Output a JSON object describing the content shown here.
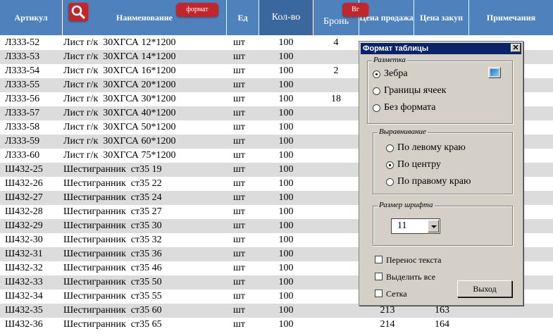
{
  "header": {
    "col_article": "Артикул",
    "col_name": "Наименование",
    "col_unit": "Ед",
    "col_qty": "Кол-во",
    "col_bron": "Бронь",
    "col_sell": "Цена продажа",
    "col_buy": "Цена закуп",
    "col_notes": "Примечания",
    "format_button": "формат",
    "bg_button": "Вг",
    "search_icon": "search-icon",
    "button_color": "#c0272d",
    "header_color": "#4f81bd"
  },
  "rows": [
    {
      "article": "Л333-52",
      "name": "Лист г/к  30ХГСА 12*1200",
      "unit": "шт",
      "qty": "100",
      "bron": "4",
      "sell": "",
      "buy": ""
    },
    {
      "article": "Л333-53",
      "name": "Лист г/к  30ХГСА 14*1200",
      "unit": "шт",
      "qty": "100",
      "bron": "",
      "sell": "",
      "buy": ""
    },
    {
      "article": "Л333-54",
      "name": "Лист г/к  30ХГСА 16*1200",
      "unit": "шт",
      "qty": "100",
      "bron": "2",
      "sell": "",
      "buy": ""
    },
    {
      "article": "Л333-55",
      "name": "Лист г/к  30ХГСА 20*1200",
      "unit": "шт",
      "qty": "100",
      "bron": "",
      "sell": "",
      "buy": ""
    },
    {
      "article": "Л333-56",
      "name": "Лист г/к  30ХГСА 30*1200",
      "unit": "шт",
      "qty": "100",
      "bron": "18",
      "sell": "",
      "buy": ""
    },
    {
      "article": "Л333-57",
      "name": "Лист г/к  30ХГСА 40*1200",
      "unit": "шт",
      "qty": "100",
      "bron": "",
      "sell": "",
      "buy": ""
    },
    {
      "article": "Л333-58",
      "name": "Лист г/к  30ХГСА 50*1200",
      "unit": "шт",
      "qty": "100",
      "bron": "",
      "sell": "",
      "buy": ""
    },
    {
      "article": "Л333-59",
      "name": "Лист г/к  30ХГСА 60*1200",
      "unit": "шт",
      "qty": "100",
      "bron": "",
      "sell": "",
      "buy": ""
    },
    {
      "article": "Л333-60",
      "name": "Лист г/к  30ХГСА 75*1200",
      "unit": "шт",
      "qty": "100",
      "bron": "",
      "sell": "",
      "buy": ""
    },
    {
      "article": "Ш432-25",
      "name": "Шестигранник  ст35 19",
      "unit": "шт",
      "qty": "100",
      "bron": "",
      "sell": "",
      "buy": ""
    },
    {
      "article": "Ш432-26",
      "name": "Шестигранник  ст35 22",
      "unit": "шт",
      "qty": "100",
      "bron": "",
      "sell": "",
      "buy": ""
    },
    {
      "article": "Ш432-27",
      "name": "Шестигранник  ст35 24",
      "unit": "шт",
      "qty": "100",
      "bron": "",
      "sell": "",
      "buy": ""
    },
    {
      "article": "Ш432-28",
      "name": "Шестигранник  ст35 27",
      "unit": "шт",
      "qty": "100",
      "bron": "",
      "sell": "",
      "buy": ""
    },
    {
      "article": "Ш432-29",
      "name": "Шестигранник  ст35 30",
      "unit": "шт",
      "qty": "100",
      "bron": "",
      "sell": "",
      "buy": ""
    },
    {
      "article": "Ш432-30",
      "name": "Шестигранник  ст35 32",
      "unit": "шт",
      "qty": "100",
      "bron": "",
      "sell": "",
      "buy": ""
    },
    {
      "article": "Ш432-31",
      "name": "Шестигранник  ст35 36",
      "unit": "шт",
      "qty": "100",
      "bron": "",
      "sell": "",
      "buy": ""
    },
    {
      "article": "Ш432-32",
      "name": "Шестигранник  ст35 46",
      "unit": "шт",
      "qty": "100",
      "bron": "",
      "sell": "",
      "buy": ""
    },
    {
      "article": "Ш432-33",
      "name": "Шестигранник  ст35 50",
      "unit": "шт",
      "qty": "100",
      "bron": "",
      "sell": "",
      "buy": ""
    },
    {
      "article": "Ш432-34",
      "name": "Шестигранник  ст35 55",
      "unit": "шт",
      "qty": "100",
      "bron": "",
      "sell": "",
      "buy": ""
    },
    {
      "article": "Ш432-35",
      "name": "Шестигранник  ст35 60",
      "unit": "шт",
      "qty": "100",
      "bron": "",
      "sell": "213",
      "buy": "163"
    },
    {
      "article": "Ш432-36",
      "name": "Шестигранник  ст35 65",
      "unit": "шт",
      "qty": "100",
      "bron": "",
      "sell": "214",
      "buy": "164"
    }
  ],
  "dialog": {
    "title": "Формат таблицы",
    "close_icon": "close-icon",
    "markup_group": "Разметка",
    "markup_options": [
      "Зебра",
      "Границы ячеек",
      "Без формата"
    ],
    "markup_selected": 0,
    "align_group": "Выравнивание",
    "align_options": [
      "По левому краю",
      "По центру",
      "По правому краю"
    ],
    "align_selected": 1,
    "font_group": "Размер шрифта",
    "font_size_value": "11",
    "wrap_text": "Перенос текста",
    "select_all": "Выделить все",
    "grid": "Сетка",
    "exit_button": "Выход",
    "title_bar_color": "#0a246a",
    "face_color": "#d4d0c8"
  }
}
